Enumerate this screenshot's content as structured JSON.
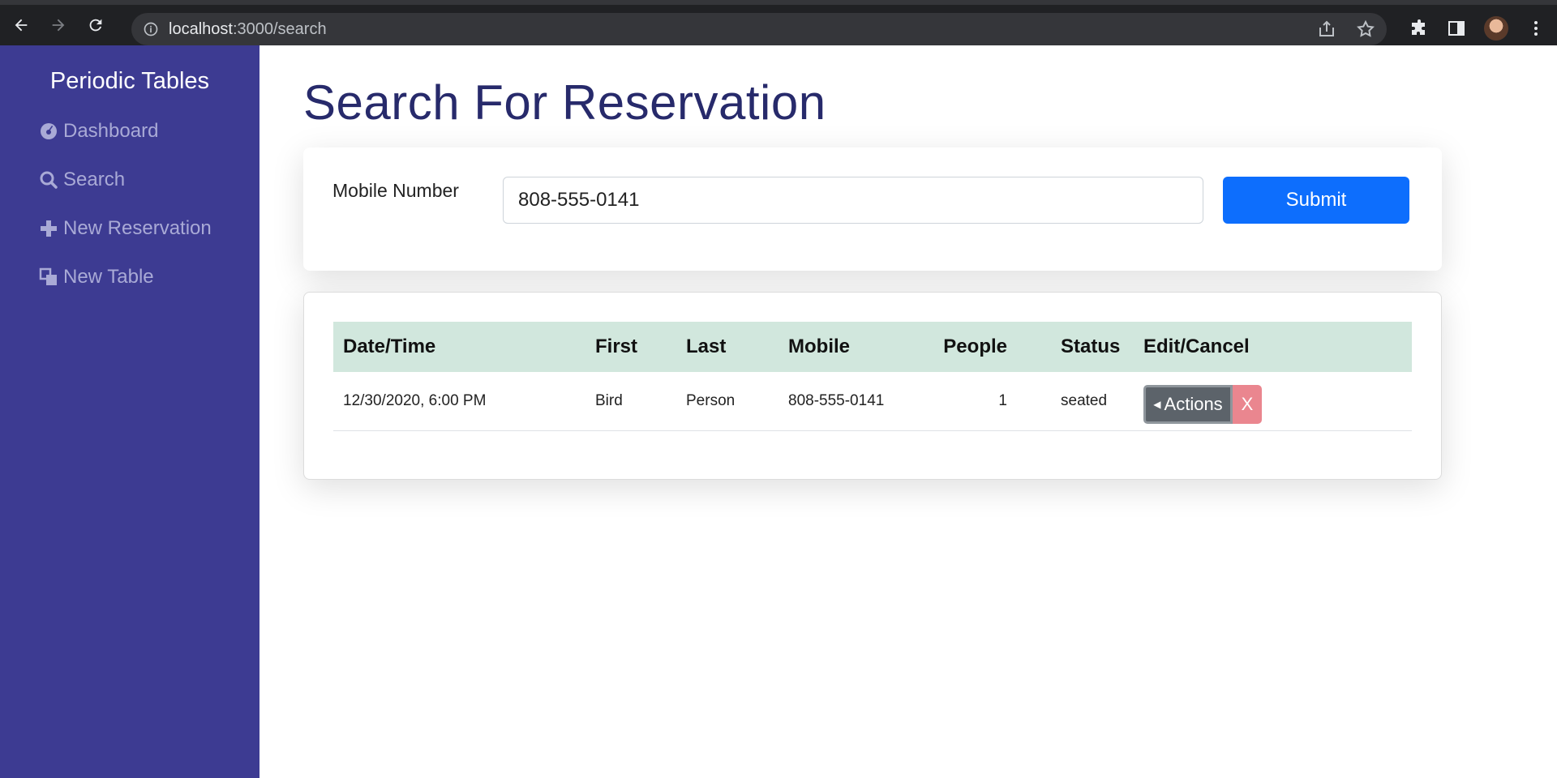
{
  "browser": {
    "url_host": "localhost",
    "url_path": ":3000/search"
  },
  "sidebar": {
    "brand": "Periodic Tables",
    "items": [
      {
        "label": "Dashboard",
        "icon": "dashboard-icon"
      },
      {
        "label": "Search",
        "icon": "search-icon"
      },
      {
        "label": "New Reservation",
        "icon": "plus-icon"
      },
      {
        "label": "New Table",
        "icon": "table-icon"
      }
    ]
  },
  "main": {
    "title": "Search For Reservation",
    "search": {
      "label": "Mobile Number",
      "value": "808-555-0141",
      "submit_label": "Submit"
    },
    "table": {
      "headers": [
        "Date/Time",
        "First",
        "Last",
        "Mobile",
        "People",
        "Status",
        "Edit/Cancel"
      ],
      "rows": [
        {
          "datetime": "12/30/2020, 6:00 PM",
          "first": "Bird",
          "last": "Person",
          "mobile": "808-555-0141",
          "people": "1",
          "status": "seated",
          "actions_label": "Actions",
          "cancel_label": "X"
        }
      ]
    }
  },
  "colors": {
    "sidebar_bg": "#3d3b92",
    "title": "#272a6b",
    "primary": "#0d6efd",
    "table_header": "#d1e7dd",
    "actions": "#5c636a",
    "cancel": "#ea868f"
  }
}
